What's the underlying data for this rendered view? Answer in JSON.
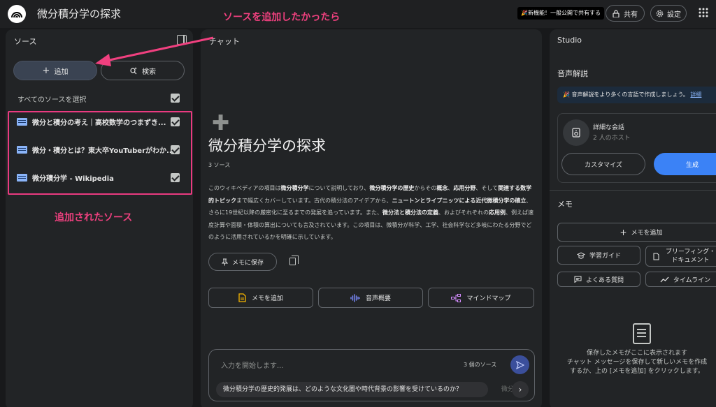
{
  "app": {
    "title": "微分積分学の探求",
    "badge_new": "🎉新機能！一般公開で共有する",
    "share_label": "共有",
    "settings_label": "設定"
  },
  "sources": {
    "panel_title": "ソース",
    "add_label": "追加",
    "search_label": "検索",
    "select_all_label": "すべてのソースを選択",
    "items": [
      {
        "label": "微分と積分の考え｜高校数学のつまずき...",
        "checked": true
      },
      {
        "label": "微分・積分とは？東大卒YouTuberがわか...",
        "checked": true
      },
      {
        "label": "微分積分学 - Wikipedia",
        "checked": true
      }
    ]
  },
  "chat": {
    "panel_title": "チャット",
    "notebook_title": "微分積分学の探求",
    "source_count": "3 ソース",
    "summary_parts": [
      {
        "t": "このウィキペディアの項目は",
        "b": false
      },
      {
        "t": "微分積分学",
        "b": true
      },
      {
        "t": "について説明しており、",
        "b": false
      },
      {
        "t": "微分積分学の歴史",
        "b": true
      },
      {
        "t": "からその",
        "b": false
      },
      {
        "t": "概念",
        "b": true
      },
      {
        "t": "、",
        "b": false
      },
      {
        "t": "応用分野",
        "b": true
      },
      {
        "t": "、そして",
        "b": false
      },
      {
        "t": "関連する数学的トピック",
        "b": true
      },
      {
        "t": "まで幅広くカバーしています。古代の積分法のアイデアから、",
        "b": false
      },
      {
        "t": "ニュートンとライプニッツによる近代微積分学の確立",
        "b": true
      },
      {
        "t": "、さらに19世紀以降の厳密化に至るまでの発展を追っています。また、",
        "b": false
      },
      {
        "t": "微分法と積分法の定義",
        "b": true
      },
      {
        "t": "、およびそれぞれの",
        "b": false
      },
      {
        "t": "応用例",
        "b": true
      },
      {
        "t": "、例えば速度計算や面積・体積の算出についても言及されています。この項目は、微積分が科学、工学、社会科学など多岐にわたる分野でどのように活用されているかを明確に示しています。",
        "b": false
      }
    ],
    "save_memo_label": "メモに保存",
    "actions": {
      "add_memo": "メモを追加",
      "audio_overview": "音声概要",
      "mind_map": "マインドマップ"
    },
    "composer_placeholder": "入力を開始します...",
    "composer_source_count": "3 個のソース",
    "suggestion": "微分積分学の歴史的発展は、どのような文化圏や時代背景の影響を受けているのか？",
    "suggestion_next": "微分"
  },
  "studio": {
    "panel_title": "Studio",
    "audio_section_title": "音声解説",
    "audio_banner_text": "🎉 音声解説をより多くの言語で作成しましょう。",
    "audio_banner_link": "詳細",
    "audio_card_title": "詳細な会話",
    "audio_card_hosts": "2 人のホスト",
    "customize_label": "カスタマイズ",
    "generate_label": "生成",
    "memo_section_title": "メモ",
    "memo_add_label": "メモを追加",
    "tools": {
      "study_guide": "学習ガイド",
      "briefing": "ブリーフィング・ドキュメント",
      "faq": "よくある質問",
      "timeline": "タイムライン"
    },
    "empty_lines": [
      "保存したメモがここに表示されます",
      "チャット メッセージを保存して新しいメモを作成",
      "するか、上の [メモを追加] をクリックします。"
    ]
  },
  "annotations": {
    "add_source_note": "ソースを追加したかったら",
    "added_sources_note": "追加されたソース",
    "color": "#f0407f"
  }
}
